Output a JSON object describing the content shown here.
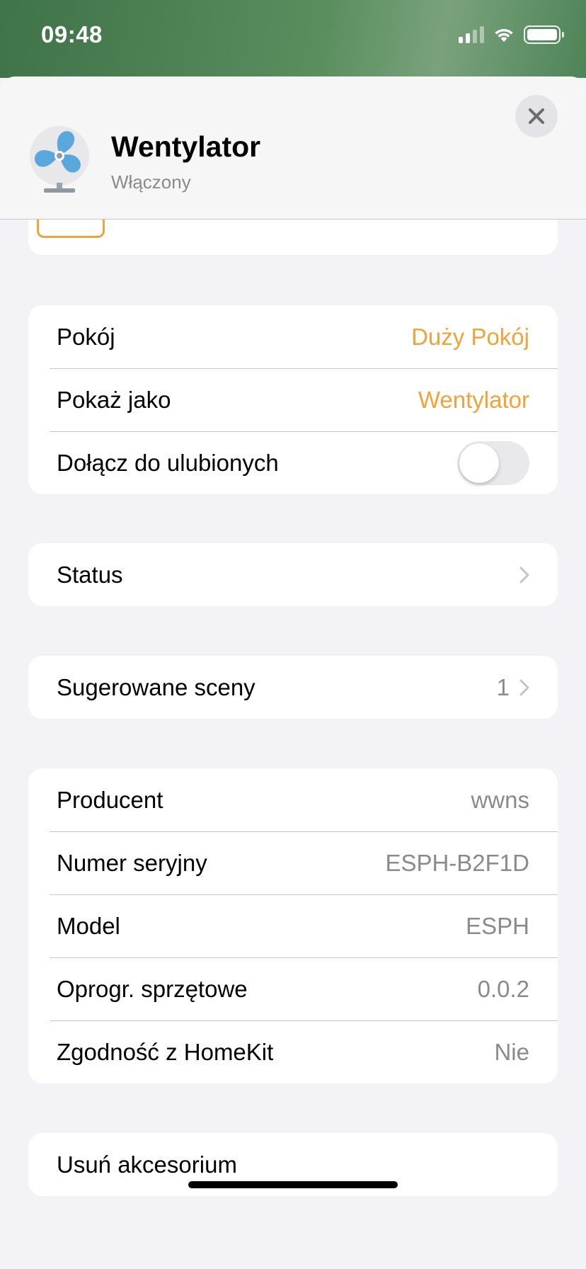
{
  "status_bar": {
    "time": "09:48",
    "signal_bars_active": 2,
    "signal_bars_total": 4,
    "battery_level": 1.0
  },
  "header": {
    "title": "Wentylator",
    "subtitle": "Włączony",
    "icon": "fan-icon",
    "close_icon": "close-icon"
  },
  "colors": {
    "accent": "#f0a33a",
    "destructive": "#e5483a",
    "secondary_text": "#8a8a8e",
    "background": "#f2f2f7"
  },
  "room_group": {
    "room_label": "Pokój",
    "room_value": "Duży Pokój",
    "display_as_label": "Pokaż jako",
    "display_as_value": "Wentylator",
    "favorites_label": "Dołącz do ulubionych",
    "favorites_on": false
  },
  "status_row": {
    "label": "Status"
  },
  "scenes_row": {
    "label": "Sugerowane sceny",
    "count": "1"
  },
  "info_group": {
    "rows": [
      {
        "label": "Producent",
        "value": "wwns"
      },
      {
        "label": "Numer seryjny",
        "value": "ESPH-B2F1D"
      },
      {
        "label": "Model",
        "value": "ESPH"
      },
      {
        "label": "Oprogr. sprzętowe",
        "value": "0.0.2"
      },
      {
        "label": "Zgodność z HomeKit",
        "value": "Nie"
      }
    ]
  },
  "remove_button": {
    "label": "Usuń akcesorium"
  }
}
